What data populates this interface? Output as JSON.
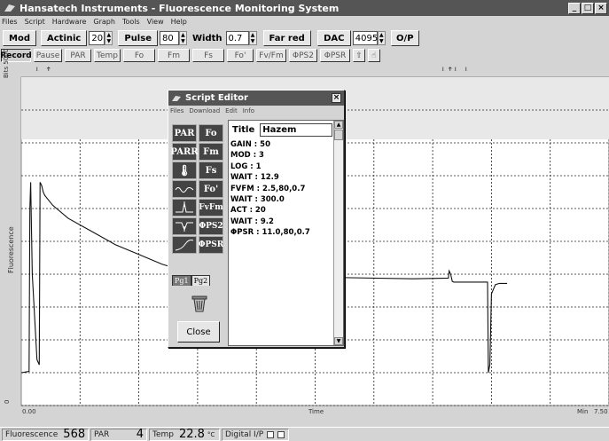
{
  "window": {
    "title": "Hansatech Instruments  -  Fluorescence Monitoring System"
  },
  "menu": [
    "Files",
    "Script",
    "Hardware",
    "Graph",
    "Tools",
    "View",
    "Help"
  ],
  "toolbar1": {
    "mod": "Mod",
    "actinic": "Actinic",
    "actinic_value": "20",
    "pulse": "Pulse",
    "pulse_value": "80",
    "width_label": "Width",
    "width_value": "0.7",
    "far_red": "Far red",
    "dac": "DAC",
    "dac_value": "4095",
    "op": "O/P"
  },
  "toolbar2": {
    "record": "Record",
    "pause": "Pause",
    "par": "PAR",
    "temp": "Temp",
    "fo": "Fo",
    "fm": "Fm",
    "fs": "Fs",
    "fo_prime": "Fo'",
    "fvfm": "Fv/Fm",
    "phips2": "ΦPS2",
    "phipsr": "ΦPSR"
  },
  "chart": {
    "ylabel_top": "Bits 5000",
    "ylabel": "Fluorescence",
    "ylabel_bottom": "0",
    "x_start": "0.00",
    "x_label": "Time",
    "x_unit": "Min",
    "x_end": "7.50"
  },
  "chart_data": {
    "type": "line",
    "title": "",
    "xlabel": "Time",
    "ylabel": "Fluorescence",
    "xlim": [
      0,
      7.5
    ],
    "ylim": [
      0,
      5000
    ],
    "series": [
      {
        "name": "",
        "x": [
          0.0,
          0.05,
          0.1,
          0.11,
          0.12,
          0.14,
          0.2,
          0.23,
          0.24,
          0.26,
          0.28,
          0.3,
          0.4,
          0.6,
          0.9,
          1.2,
          1.5,
          1.8,
          2.0,
          3.0,
          4.0,
          5.0,
          5.45,
          5.46,
          5.48,
          5.5,
          5.52,
          5.55,
          5.6,
          5.7,
          5.8,
          5.9,
          5.95,
          5.96,
          5.98,
          6.0,
          6.05,
          6.1,
          6.15,
          6.2
        ],
        "y": [
          500,
          510,
          520,
          3000,
          3400,
          2000,
          700,
          620,
          3400,
          3350,
          3250,
          3200,
          3050,
          2850,
          2650,
          2450,
          2300,
          2150,
          2080,
          2000,
          1950,
          1930,
          1940,
          2050,
          2000,
          1890,
          1880,
          1880,
          1880,
          1880,
          1880,
          1880,
          1880,
          500,
          620,
          1700,
          1840,
          1860,
          1860,
          1860
        ]
      }
    ]
  },
  "status": {
    "fluorescence_label": "Fluorescence",
    "fluorescence_value": "568",
    "par_label": "PAR",
    "par_value": "4",
    "temp_label": "Temp",
    "temp_value": "22.8",
    "temp_unit": "°C",
    "digital_label": "Digital I/P"
  },
  "editor": {
    "title": "Script Editor",
    "menu": [
      "Files",
      "Download",
      "Edit",
      "Info"
    ],
    "tools": {
      "par": "PAR",
      "fo": "Fo",
      "parr": "PARR",
      "fm": "Fm",
      "fs": "Fs",
      "fo_prime": "Fo'",
      "fvfm": "FvFm",
      "phips2": "ΦPS2",
      "phipsr": "ΦPSR"
    },
    "tabs": [
      "Pg1",
      "Pg2"
    ],
    "close": "Close",
    "title_label": "Title",
    "title_value": "Hazem",
    "lines": [
      "GAIN : 50",
      "MOD : 3",
      "LOG : 1",
      "WAIT : 12.9",
      "FVFM : 2.5,80,0.7",
      "WAIT : 300.0",
      "ACT : 20",
      "WAIT : 9.2",
      "ΦPSR : 11.0,80,0.7"
    ]
  }
}
